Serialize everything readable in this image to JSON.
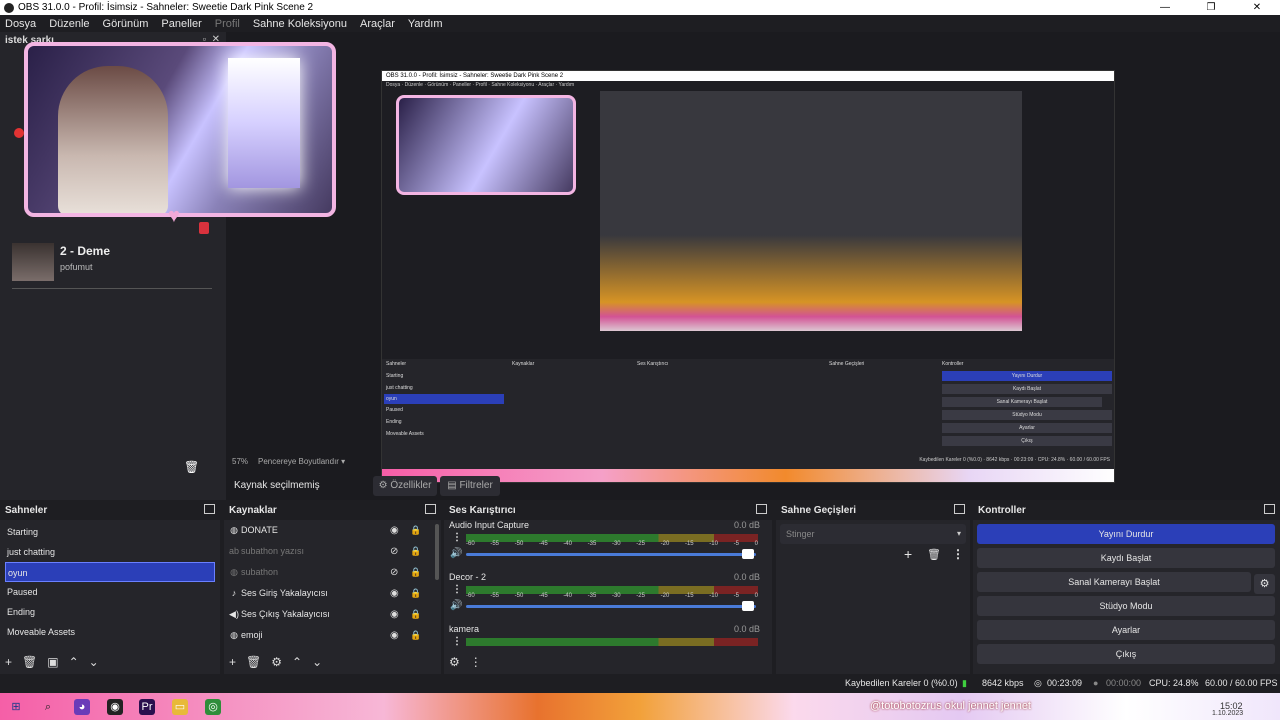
{
  "window": {
    "title": "OBS 31.0.0 - Profil: İsimsiz - Sahneler: Sweetie Dark Pink Scene 2",
    "controls": [
      "—",
      "❐",
      "✕"
    ]
  },
  "menu": [
    "Dosya",
    "Düzenle",
    "Görünüm",
    "Paneller",
    "Profil",
    "Sahne Koleksiyonu",
    "Araçlar",
    "Yardım"
  ],
  "song_dock": {
    "title": "istek şarkı",
    "song_title": "2 - Deme",
    "song_artist": "pofumut"
  },
  "preview": {
    "zoom": "57%",
    "zoom_mode": "Pencereye Boyutlandır",
    "no_source": "Kaynak seçilmemiş",
    "properties": "Özellikler",
    "filters": "Filtreler"
  },
  "scenes": {
    "title": "Sahneler",
    "items": [
      "Starting",
      "just chatting",
      "oyun",
      "Paused",
      "Ending",
      "Moveable Assets"
    ],
    "selected": 2
  },
  "sources": {
    "title": "Kaynaklar",
    "items": [
      {
        "name": "DONATE",
        "icon": "globe-icon",
        "glyph": "◍",
        "visible": true
      },
      {
        "name": "subathon yazısı",
        "icon": "text-icon",
        "glyph": "ab",
        "visible": false
      },
      {
        "name": "subathon",
        "icon": "globe-icon",
        "glyph": "◍",
        "visible": false
      },
      {
        "name": "Ses Giriş Yakalayıcısı",
        "icon": "mic-icon",
        "glyph": "♪",
        "visible": true
      },
      {
        "name": "Ses Çıkış Yakalayıcısı",
        "icon": "speaker-icon",
        "glyph": "◀)",
        "visible": true
      },
      {
        "name": "emoji",
        "icon": "globe-icon",
        "glyph": "◍",
        "visible": true
      }
    ]
  },
  "mixer": {
    "title": "Ses Karıştırıcı",
    "ticks": [
      "-60",
      "-55",
      "-50",
      "-45",
      "-40",
      "-35",
      "-30",
      "-25",
      "-20",
      "-15",
      "-10",
      "-5",
      "0"
    ],
    "channels": [
      {
        "name": "Audio Input Capture",
        "db": "0.0 dB"
      },
      {
        "name": "Decor - 2",
        "db": "0.0 dB"
      },
      {
        "name": "kamera",
        "db": "0.0 dB"
      }
    ]
  },
  "transitions": {
    "title": "Sahne Geçişleri",
    "selected": "Stinger"
  },
  "controls": {
    "title": "Kontroller",
    "buttons": [
      "Yayını Durdur",
      "Kaydı Başlat",
      "Sanal Kamerayı Başlat",
      "Stüdyo Modu",
      "Ayarlar",
      "Çıkış"
    ]
  },
  "status": {
    "dropped": "Kaybedilen Kareler 0 (%0.0)",
    "bitrate": "8642 kbps",
    "stream_time": "00:23:09",
    "rec_time": "00:00:00",
    "cpu": "CPU: 24.8%",
    "fps": "60.00 / 60.00 FPS"
  },
  "taskbar": {
    "ticker": "@totobotozrus okul jennet jennet",
    "clock_time": "15:02",
    "clock_date": "1.10.2023"
  },
  "colors": {
    "accent": "#2b3fb8",
    "cam_border": "#f3b5e3"
  }
}
